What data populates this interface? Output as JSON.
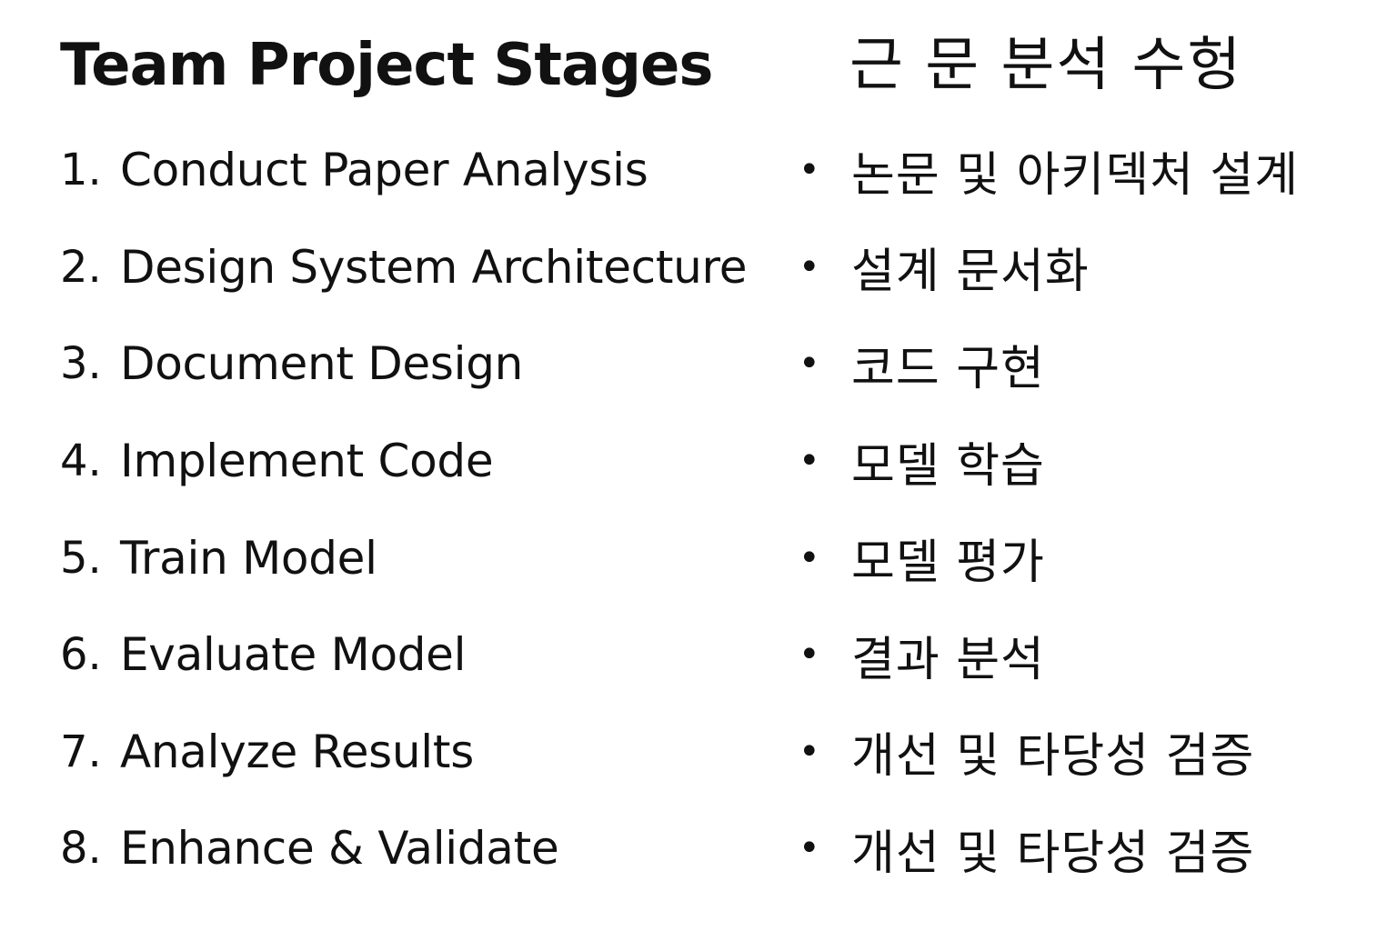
{
  "left": {
    "title": "Team Project Stages",
    "items": [
      {
        "num": "1.",
        "label": "Conduct Paper Analysis"
      },
      {
        "num": "2.",
        "label": "Design System Architecture"
      },
      {
        "num": "3.",
        "label": "Document Design"
      },
      {
        "num": "4.",
        "label": "Implement Code"
      },
      {
        "num": "5.",
        "label": "Train Model"
      },
      {
        "num": "6.",
        "label": "Evaluate Model"
      },
      {
        "num": "7.",
        "label": "Analyze Results"
      },
      {
        "num": "8.",
        "label": "Enhance & Validate"
      }
    ]
  },
  "right": {
    "title": "근 문 분석 수헝",
    "bullet": "•",
    "items": [
      {
        "label": "논문 및 아키덱처 설계"
      },
      {
        "label": "설계 문서화"
      },
      {
        "label": "코드 구현"
      },
      {
        "label": "모델 학습"
      },
      {
        "label": "모델 평가"
      },
      {
        "label": "결과 분석"
      },
      {
        "label": "개선 및 타당성 검증"
      },
      {
        "label": "개선 및 타당성 검증"
      }
    ]
  }
}
